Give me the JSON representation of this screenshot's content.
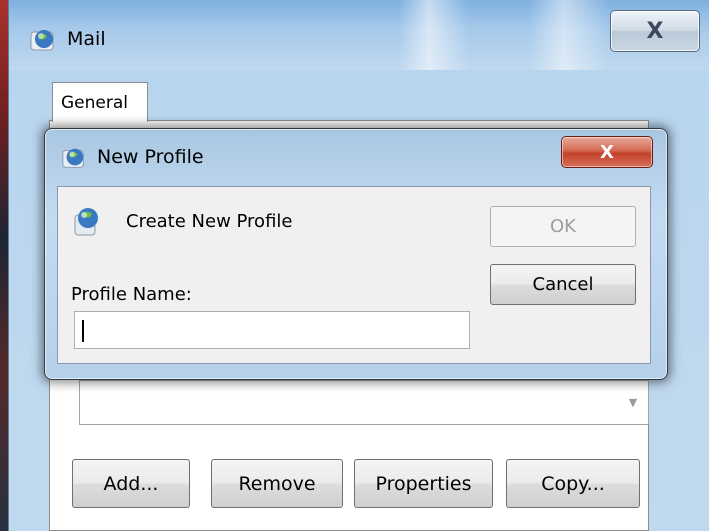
{
  "mail_window": {
    "title": "Mail",
    "close_glyph": "X",
    "tab_label": "General",
    "buttons": {
      "add": "Add...",
      "remove": "Remove",
      "properties": "Properties",
      "copy": "Copy..."
    }
  },
  "new_profile_dialog": {
    "title": "New Profile",
    "close_glyph": "X",
    "create_label": "Create New Profile",
    "ok_label": "OK",
    "cancel_label": "Cancel",
    "profile_name_label": "Profile Name:",
    "profile_name_value": ""
  },
  "icons": {
    "mail": "mail-globe-icon",
    "dialog": "mail-globe-icon",
    "create": "new-profile-icon",
    "combo_arrow": "chevron-down-icon"
  },
  "colors": {
    "dialog_close_red": "#c2412a",
    "frame_blue": "#b5d0eb"
  }
}
